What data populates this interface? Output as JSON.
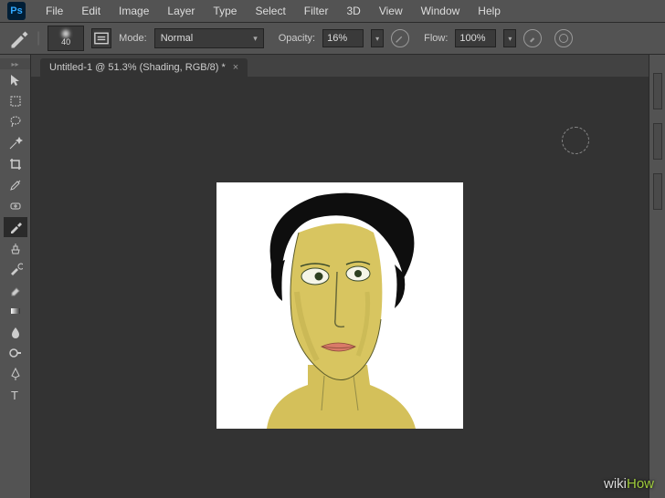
{
  "app": {
    "logo": "Ps"
  },
  "menu": [
    "File",
    "Edit",
    "Image",
    "Layer",
    "Type",
    "Select",
    "Filter",
    "3D",
    "View",
    "Window",
    "Help"
  ],
  "options": {
    "brush_size": "40",
    "mode_label": "Mode:",
    "mode_value": "Normal",
    "opacity_label": "Opacity:",
    "opacity_value": "16%",
    "flow_label": "Flow:",
    "flow_value": "100%"
  },
  "tab": {
    "title": "Untitled-1 @ 51.3% (Shading, RGB/8) *",
    "close": "×"
  },
  "watermark": {
    "wiki": "wiki",
    "how": "How"
  }
}
